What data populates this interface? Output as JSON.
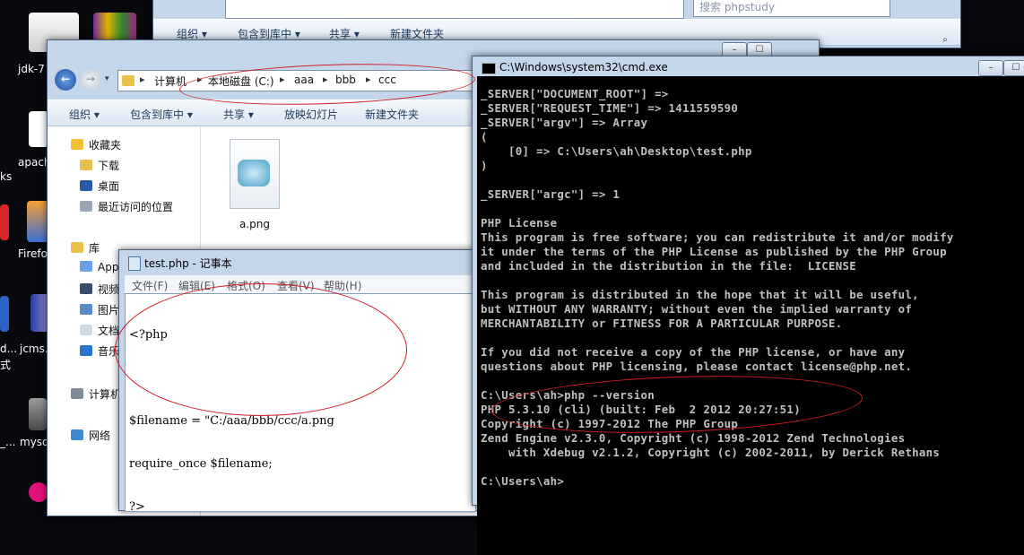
{
  "desktop": {
    "icons": [
      {
        "label": "jdk-7",
        "color": "#e9e9e9"
      },
      {
        "label": "",
        "color": "#7a2aa0"
      },
      {
        "label": "apach",
        "color": "#ffffff"
      },
      {
        "label": "ks",
        "color": ""
      },
      {
        "label": "Firefo",
        "color": "#3a6fd8"
      },
      {
        "label": "jcms.",
        "color": "#3b4bb0"
      },
      {
        "label": "d...",
        "color": ""
      },
      {
        "label": "式",
        "color": ""
      },
      {
        "label": "mysq",
        "color": "#5a5a5a"
      },
      {
        "label": "_...",
        "color": ""
      }
    ]
  },
  "back_explorer": {
    "toolbar": [
      "组织 ▾",
      "包含到库中 ▾",
      "共享 ▾",
      "新建文件夹"
    ],
    "search_placeholder": "搜索 phpstudy"
  },
  "explorer": {
    "breadcrumb": [
      "计算机",
      "本地磁盘 (C:)",
      "aaa",
      "bbb",
      "ccc"
    ],
    "toolbar": {
      "organize": "组织 ▾",
      "include_library": "包含到库中 ▾",
      "share": "共享 ▾",
      "slideshow": "放映幻灯片",
      "new_folder": "新建文件夹"
    },
    "nav": {
      "favorites": "收藏夹",
      "downloads": "下载",
      "desktop": "桌面",
      "recent": "最近访问的位置",
      "libraries": "库",
      "apps": "App",
      "videos": "视频",
      "pictures": "图片",
      "docs": "文档",
      "music": "音乐",
      "computer": "计算机",
      "network": "网络"
    },
    "file": {
      "name": "a.png"
    }
  },
  "notepad": {
    "title": "test.php - 记事本",
    "menu": [
      "文件(F)",
      "编辑(E)",
      "格式(O)",
      "查看(V)",
      "帮助(H)"
    ],
    "lines": [
      "<?php",
      "",
      "$filename = \"C:/aaa/bbb/ccc/a.png",
      "require_once $filename;",
      "?>"
    ]
  },
  "cmd": {
    "title": "C:\\Windows\\system32\\cmd.exe",
    "lines": [
      "_SERVER[\"DOCUMENT_ROOT\"] =>",
      "_SERVER[\"REQUEST_TIME\"] => 1411559590",
      "_SERVER[\"argv\"] => Array",
      "(",
      "    [0] => C:\\Users\\ah\\Desktop\\test.php",
      ")",
      "",
      "_SERVER[\"argc\"] => 1",
      "",
      "PHP License",
      "This program is free software; you can redistribute it and/or modify",
      "it under the terms of the PHP License as published by the PHP Group",
      "and included in the distribution in the file:  LICENSE",
      "",
      "This program is distributed in the hope that it will be useful,",
      "but WITHOUT ANY WARRANTY; without even the implied warranty of",
      "MERCHANTABILITY or FITNESS FOR A PARTICULAR PURPOSE.",
      "",
      "If you did not receive a copy of the PHP license, or have any",
      "questions about PHP licensing, please contact license@php.net.",
      "",
      "C:\\Users\\ah>php --version",
      "PHP 5.3.10 (cli) (built: Feb  2 2012 20:27:51)",
      "Copyright (c) 1997-2012 The PHP Group",
      "Zend Engine v2.3.0, Copyright (c) 1998-2012 Zend Technologies",
      "    with Xdebug v2.1.2, Copyright (c) 2002-2011, by Derick Rethans",
      "",
      "C:\\Users\\ah>"
    ]
  },
  "colors": {
    "annotation": "#d21d24",
    "cmd_bg": "#000000",
    "cmd_text": "#c0c0c0",
    "aero_frame": "#c4d6ea"
  }
}
